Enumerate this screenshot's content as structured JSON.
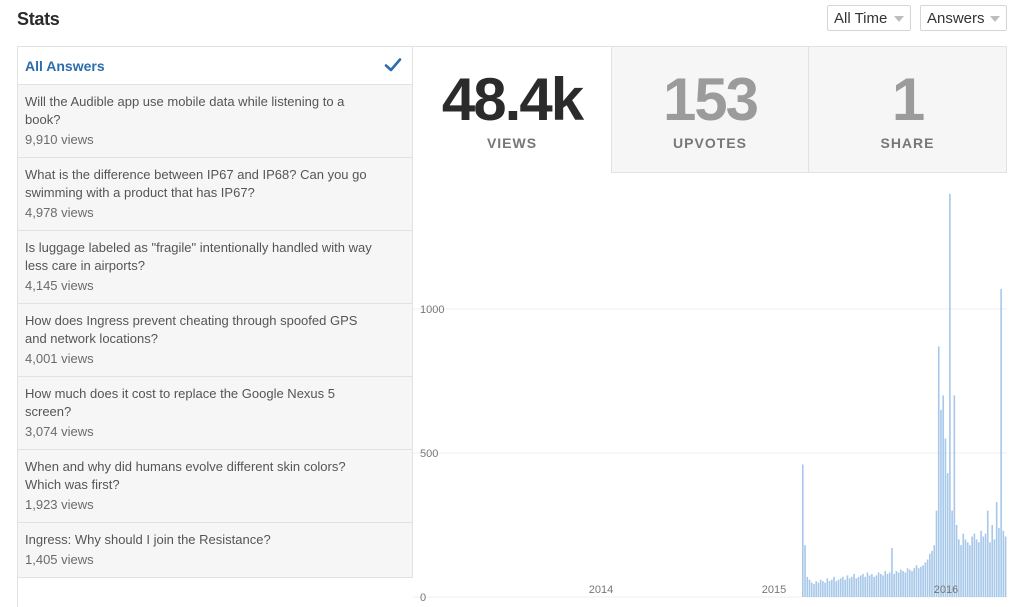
{
  "header": {
    "title": "Stats",
    "time_filter": "All Time",
    "type_filter": "Answers"
  },
  "sidebar": {
    "all_label": "All Answers",
    "items": [
      {
        "question": "Will the Audible app use mobile data while listening to a book?",
        "views": "9,910 views"
      },
      {
        "question": "What is the difference between IP67 and IP68? Can you go swimming with a product that has IP67?",
        "views": "4,978 views"
      },
      {
        "question": "Is luggage labeled as \"fragile\" intentionally handled with way less care in airports?",
        "views": "4,145 views"
      },
      {
        "question": "How does Ingress prevent cheating through spoofed GPS and network locations?",
        "views": "4,001 views"
      },
      {
        "question": "How much does it cost to replace the Google Nexus 5 screen?",
        "views": "3,074 views"
      },
      {
        "question": "When and why did humans evolve different skin colors? Which was first?",
        "views": "1,923 views"
      },
      {
        "question": "Ingress: Why should I join the Resistance?",
        "views": "1,405 views"
      }
    ]
  },
  "stats": {
    "views": {
      "value": "48.4k",
      "label": "VIEWS"
    },
    "upvotes": {
      "value": "153",
      "label": "UPVOTES"
    },
    "share": {
      "value": "1",
      "label": "SHARE"
    }
  },
  "colors": {
    "accent": "#2b6dad",
    "bar": "#a8c8ea"
  },
  "chart_data": {
    "type": "area",
    "title": "",
    "xlabel": "",
    "ylabel": "",
    "y_ticks": [
      0,
      500,
      1000
    ],
    "ylim": [
      0,
      1400
    ],
    "x_ticks": [
      "2014",
      "2015",
      "2016"
    ],
    "grid": true,
    "series": [
      {
        "values": [
          460,
          180,
          70,
          60,
          50,
          45,
          55,
          50,
          60,
          55,
          50,
          65,
          55,
          60,
          70,
          55,
          60,
          65,
          70,
          60,
          75,
          65,
          70,
          80,
          65,
          70,
          75,
          80,
          70,
          85,
          75,
          80,
          70,
          75,
          85,
          80,
          75,
          90,
          80,
          85,
          170,
          80,
          90,
          85,
          95,
          90,
          85,
          100,
          95,
          90,
          100,
          110,
          100,
          105,
          110,
          120,
          130,
          150,
          160,
          180,
          300,
          870,
          650,
          700,
          550,
          430,
          1400,
          300,
          700,
          250,
          200,
          180,
          220,
          200,
          190,
          180,
          210,
          220,
          200,
          190,
          230,
          210,
          220,
          300,
          190,
          250,
          200,
          330,
          240,
          1070,
          230,
          210
        ]
      }
    ]
  }
}
